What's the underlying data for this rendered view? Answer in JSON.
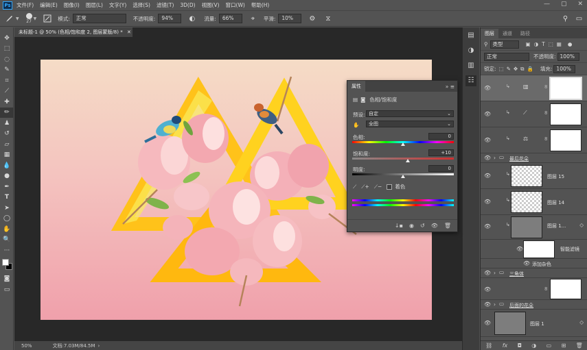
{
  "app": {
    "logo": "Ps"
  },
  "menu": [
    "文件(F)",
    "编辑(E)",
    "图像(I)",
    "图层(L)",
    "文字(Y)",
    "选择(S)",
    "滤镜(T)",
    "3D(D)",
    "视图(V)",
    "窗口(W)",
    "帮助(H)"
  ],
  "window_controls": [
    "minimize-icon",
    "restore-icon",
    "close-icon"
  ],
  "options": {
    "brush_size": "27",
    "mode_label": "模式:",
    "mode_value": "正常",
    "opacity_label": "不透明度:",
    "opacity_value": "94%",
    "flow_label": "流量:",
    "flow_value": "66%",
    "smooth_label": "平滑:",
    "smooth_value": "10%"
  },
  "document": {
    "tab_title": "未标题-1 @ 50% (色相/饱和度 2, 图层蒙版/8) *",
    "zoom": "50%",
    "doc_size": "文档:7.03M/84.5M"
  },
  "properties": {
    "tab": "属性",
    "adjustment_name": "色相/饱和度",
    "preset_label": "预设:",
    "preset_value": "自定",
    "channel_value": "全图",
    "hue_label": "色相:",
    "hue_value": "0",
    "saturation_label": "饱和度:",
    "saturation_value": "+10",
    "lightness_label": "明度:",
    "lightness_value": "0",
    "colorize_label": "着色",
    "hue": 0,
    "saturation": 10,
    "lightness": 0
  },
  "layers": {
    "tabs": [
      "图层",
      "通道",
      "路径"
    ],
    "filter_kind": "类型",
    "blend_mode": "正常",
    "opacity_label": "不透明度:",
    "opacity_value": "100%",
    "lock_label": "锁定:",
    "fill_label": "填充:",
    "fill_value": "100%",
    "items": [
      {
        "name": "",
        "kind": "adjustment"
      },
      {
        "name": "",
        "kind": "adjustment"
      },
      {
        "name": "",
        "kind": "adjustment"
      },
      {
        "name": "最后花朵",
        "kind": "group"
      },
      {
        "name": "图层 15",
        "kind": "pixel"
      },
      {
        "name": "图层 14",
        "kind": "pixel"
      },
      {
        "name": "图层 1...",
        "kind": "smart"
      },
      {
        "name": "智能滤镜",
        "kind": "filter"
      },
      {
        "name": "添加杂色",
        "kind": "filter-item"
      },
      {
        "name": "三角体",
        "kind": "group"
      },
      {
        "name": "后面的花朵",
        "kind": "group"
      },
      {
        "name": "图层 1",
        "kind": "smart"
      }
    ]
  },
  "colors": {
    "ui_bg": "#535353",
    "canvas_top": "#f5dcc6",
    "canvas_bottom": "#f0a0ab",
    "triangle": "#ffc21a",
    "flower": "#f4b3b9",
    "accent": "#31a8ff"
  }
}
